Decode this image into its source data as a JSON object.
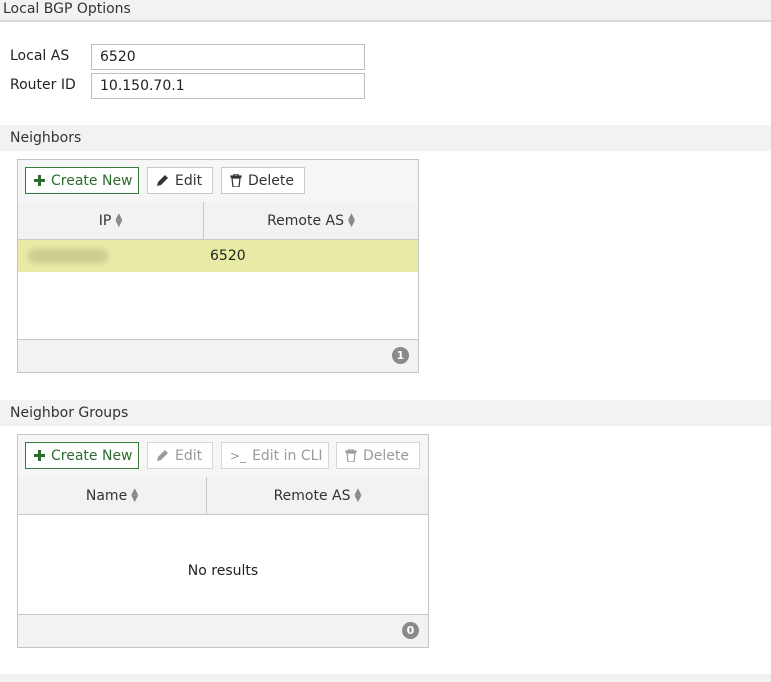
{
  "local_bgp": {
    "header": "Local BGP Options",
    "local_as_label": "Local AS",
    "local_as_value": "6520",
    "router_id_label": "Router ID",
    "router_id_value": "10.150.70.1"
  },
  "neighbors": {
    "header": "Neighbors",
    "toolbar": {
      "create_label": "Create New",
      "edit_label": "Edit",
      "delete_label": "Delete"
    },
    "columns": [
      "IP",
      "Remote AS"
    ],
    "rows": [
      {
        "ip": "",
        "remote_as": "6520"
      }
    ],
    "count": "1"
  },
  "neighbor_groups": {
    "header": "Neighbor Groups",
    "toolbar": {
      "create_label": "Create New",
      "edit_label": "Edit",
      "edit_cli_label": "Edit in CLI",
      "delete_label": "Delete"
    },
    "columns": [
      "Name",
      "Remote AS"
    ],
    "empty_text": "No results",
    "count": "0"
  },
  "icons": {
    "create": "plus-icon",
    "edit": "pencil-icon",
    "delete": "trash-icon",
    "cli": "terminal-icon",
    "sort": "sort-icon",
    "count": "count-badge"
  },
  "colors": {
    "selected_row": "#e8eba5",
    "primary_button": "#3a7d3a"
  }
}
